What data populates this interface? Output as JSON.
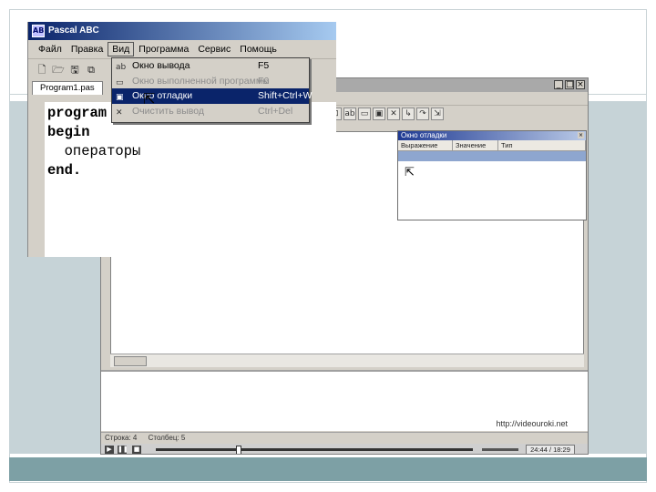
{
  "app": {
    "title": "Pascal ABC",
    "icon_label": "AB",
    "menu": [
      "Файл",
      "Правка",
      "Вид",
      "Программа",
      "Сервис",
      "Помощь"
    ],
    "tab_label": "Program1.pas"
  },
  "view_menu": {
    "items": [
      {
        "label": "Окно вывода",
        "shortcut": "F5",
        "icon": "output-window-icon",
        "glyph": "ab",
        "disabled": false,
        "highlighted": false
      },
      {
        "label": "Окно выполненной программы",
        "shortcut": "F6",
        "icon": "program-window-icon",
        "glyph": "▭",
        "disabled": true,
        "highlighted": false
      },
      {
        "label": "Окно отладки",
        "shortcut": "Shift+Ctrl+W",
        "icon": "debug-window-icon",
        "glyph": "▣",
        "disabled": false,
        "highlighted": true
      },
      {
        "label": "Очистить вывод",
        "shortcut": "Ctrl+Del",
        "icon": "clear-output-icon",
        "glyph": "✕",
        "disabled": true,
        "highlighted": false
      }
    ]
  },
  "code_lines": [
    {
      "text": "program",
      "indent": "",
      "bold": true
    },
    {
      "text": "begin",
      "indent": "",
      "bold": true
    },
    {
      "text": "операторы",
      "indent": "  ",
      "bold": false
    },
    {
      "text": "end.",
      "indent": "",
      "bold": true
    }
  ],
  "debug_window": {
    "title": "Окно отладки",
    "columns": [
      "Выражение",
      "Значение",
      "Тип"
    ]
  },
  "status": {
    "row": "Строка: 4",
    "col": "Столбец: 5"
  },
  "player": {
    "time": "24:44 / 18:29"
  },
  "watermark": "http://videouroki.net",
  "colors": {
    "titlebar_active": "#0a246a",
    "menu_highlight": "#0a246a",
    "slide_band": "#c6d3d7",
    "slide_bottom": "#7da0a5"
  }
}
